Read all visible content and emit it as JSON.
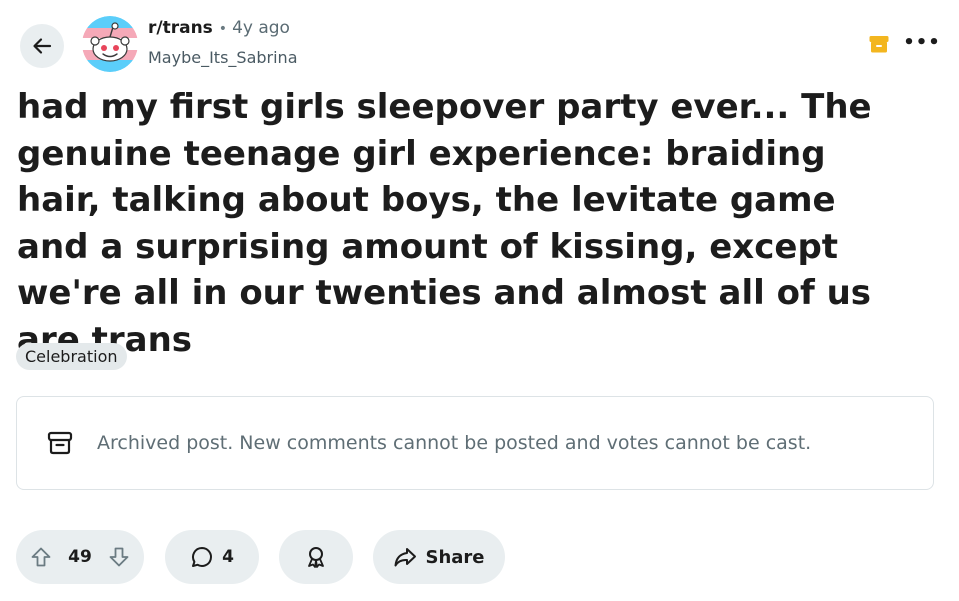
{
  "header": {
    "back_icon": "arrow-left-icon",
    "subreddit": "r/trans",
    "separator": "•",
    "age": "4y ago",
    "author": "Maybe_Its_Sabrina",
    "archived_icon": "archive-box-icon",
    "more_label": "•••"
  },
  "post": {
    "title": "had my first girls sleepover party ever... The genuine teenage girl experience: braiding hair, talking about boys, the levitate game and a surprising amount of kissing, except we're all in our twenties and almost all of us are trans",
    "flair": "Celebration"
  },
  "archive_notice": {
    "icon": "archive-icon",
    "text": "Archived post. New comments cannot be posted and votes cannot be cast."
  },
  "actions": {
    "upvote_icon": "upvote-arrow-icon",
    "score": "49",
    "downvote_icon": "downvote-arrow-icon",
    "comment_icon": "speech-bubble-icon",
    "comments": "4",
    "award_icon": "award-ribbon-icon",
    "share_icon": "share-arrow-icon",
    "share_label": "Share"
  },
  "colors": {
    "text": "#1c1c1c",
    "muted": "#5f6e75",
    "pill_bg": "#e9eef0",
    "archive_yellow": "#f3b61f",
    "trans_blue": "#5bcefa",
    "trans_pink": "#f5a9b8"
  }
}
